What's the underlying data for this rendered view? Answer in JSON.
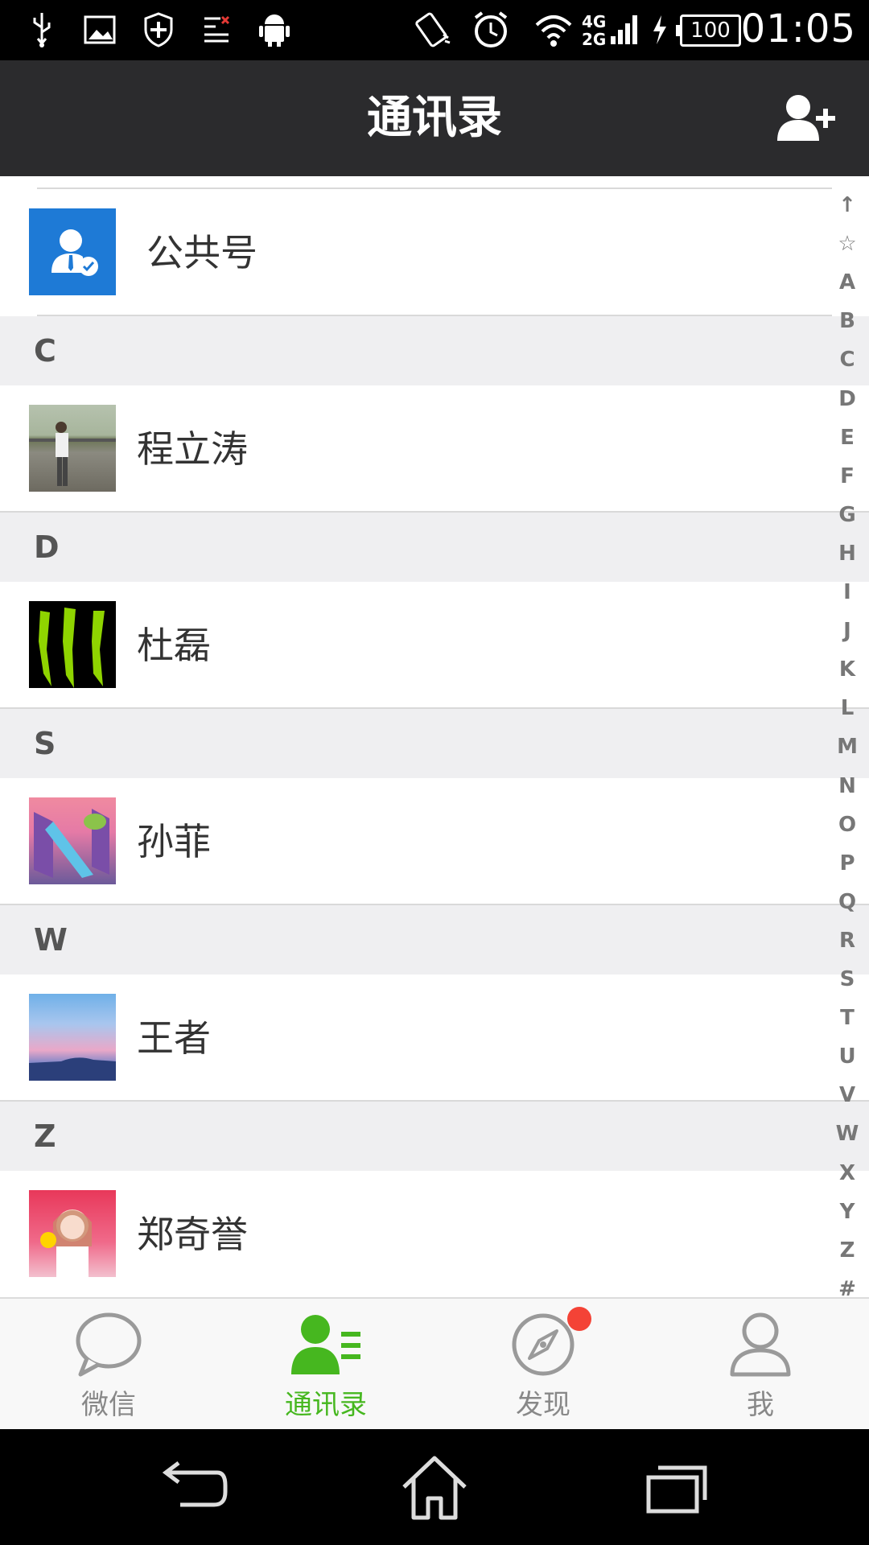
{
  "status_bar": {
    "time": "01:05",
    "battery": "100",
    "network_top": "4G",
    "network_bottom": "2G"
  },
  "header": {
    "title": "通讯录"
  },
  "public_account": {
    "label": "公共号"
  },
  "sections": [
    {
      "letter": "C",
      "contacts": [
        {
          "name": "程立涛"
        }
      ]
    },
    {
      "letter": "D",
      "contacts": [
        {
          "name": "杜磊"
        }
      ]
    },
    {
      "letter": "S",
      "contacts": [
        {
          "name": "孙菲"
        }
      ]
    },
    {
      "letter": "W",
      "contacts": [
        {
          "name": "王者"
        }
      ]
    },
    {
      "letter": "Z",
      "contacts": [
        {
          "name": "郑奇誉"
        }
      ]
    }
  ],
  "index_bar": [
    "↑",
    "☆",
    "A",
    "B",
    "C",
    "D",
    "E",
    "F",
    "G",
    "H",
    "I",
    "J",
    "K",
    "L",
    "M",
    "N",
    "O",
    "P",
    "Q",
    "R",
    "S",
    "T",
    "U",
    "V",
    "W",
    "X",
    "Y",
    "Z",
    "#"
  ],
  "bottom_nav": [
    {
      "label": "微信",
      "active": false
    },
    {
      "label": "通讯录",
      "active": true
    },
    {
      "label": "发现",
      "active": false,
      "badge": true
    },
    {
      "label": "我",
      "active": false
    }
  ],
  "colors": {
    "accent_green": "#46b71f",
    "header_bg": "#2b2b2d",
    "badge_red": "#f44336",
    "public_account_blue": "#1e7ad6"
  }
}
